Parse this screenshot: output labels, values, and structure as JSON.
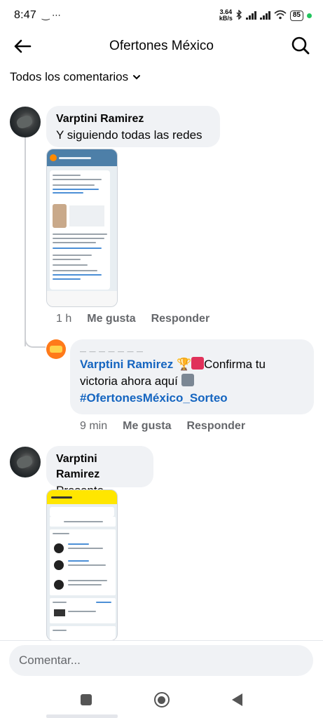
{
  "status_bar": {
    "time": "8:47",
    "left_icons": "‿ ⋯",
    "net_speed_value": "3.64",
    "net_speed_unit": "kB/s",
    "battery": "85"
  },
  "header": {
    "title": "Ofertones México"
  },
  "filter": {
    "label": "Todos los comentarios"
  },
  "comments": [
    {
      "author": "Varptini Ramirez",
      "text": "Y siguiendo todas las redes",
      "time": "1 h",
      "like": "Me gusta",
      "reply": "Responder"
    },
    {
      "author": "Varptini Ramirez",
      "text": "Presente"
    }
  ],
  "reply": {
    "dashes": "— — —  — —  — —",
    "mention": "Varptini Ramirez",
    "body": "Confirma tu victoria ahora aquí",
    "hashtag": "#OfertonesMéxico_Sorteo",
    "time": "9 min",
    "like": "Me gusta",
    "reply": "Responder"
  },
  "composer": {
    "placeholder": "Comentar..."
  },
  "colors": {
    "link_blue": "#1565c0",
    "bubble_bg": "#f0f2f5",
    "muted": "#65676b"
  }
}
